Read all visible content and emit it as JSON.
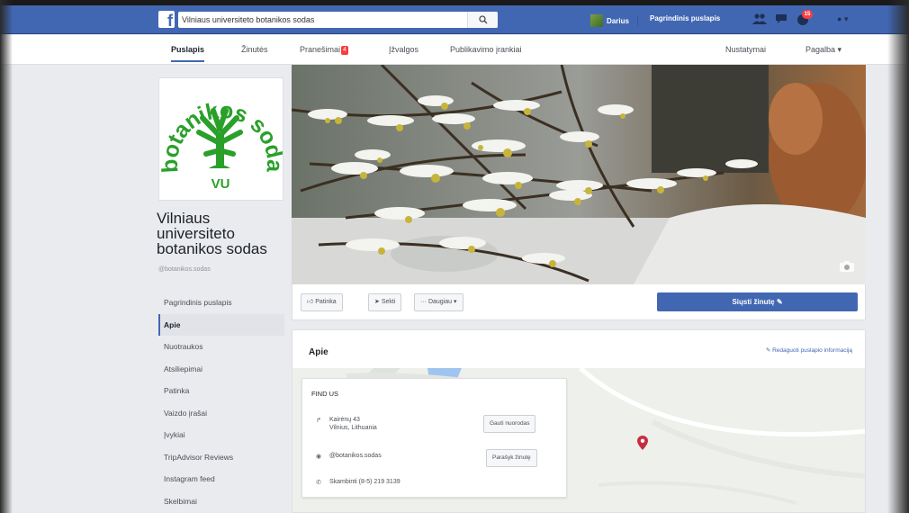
{
  "topbar": {
    "logo": "f",
    "search_value": "Vilniaus universiteto botanikos sodas",
    "search_icon": "search-icon",
    "user_name": "Darius",
    "home_label": "Pagrindinis puslapis",
    "notifications_count": "15",
    "settings_label": "▾"
  },
  "subnav": {
    "items": [
      {
        "label": "Puslapis"
      },
      {
        "label": "Žinutės"
      },
      {
        "label": "Pranešimai"
      },
      {
        "label": "Įžvalgos"
      },
      {
        "label": "Publikavimo įrankiai"
      },
      {
        "label": "Nustatymai"
      },
      {
        "label": "Pagalba ▾"
      }
    ],
    "notif_badge": "4"
  },
  "page": {
    "name": "Vilniaus universiteto botanikos sodas",
    "handle": "@botanikos.sodas",
    "logo_text": "botanikos sodas",
    "logo_vu": "VU"
  },
  "left_nav": [
    {
      "label": "Pagrindinis puslapis"
    },
    {
      "label": "Apie"
    },
    {
      "label": "Nuotraukos"
    },
    {
      "label": "Atsiliepimai"
    },
    {
      "label": "Patinka"
    },
    {
      "label": "Vaizdo įrašai"
    },
    {
      "label": "Įvykiai"
    },
    {
      "label": "TripAdvisor Reviews"
    },
    {
      "label": "Instagram feed"
    },
    {
      "label": "Skelbimai"
    }
  ],
  "actions": {
    "like": "Patinka",
    "follow": "Sekti",
    "more": "Daugiau ▾",
    "send": "Siųsti žinutę"
  },
  "about": {
    "title": "Apie",
    "edit_link": "Redaguoti puslapio informaciją",
    "find_us": "FIND US",
    "address_line1": "Kairėnų 43",
    "address_line2": "Vilnius, Lithuania",
    "directions_btn": "Gauti nuorodas",
    "messenger": "@botanikos.sodas",
    "send_msg_btn": "Parašyk žinutę",
    "phone": "Skambinti (8-5) 219 3139"
  },
  "colors": {
    "brand": "#4267b2",
    "background": "#e9ebee",
    "alert": "#fa3e3e"
  }
}
